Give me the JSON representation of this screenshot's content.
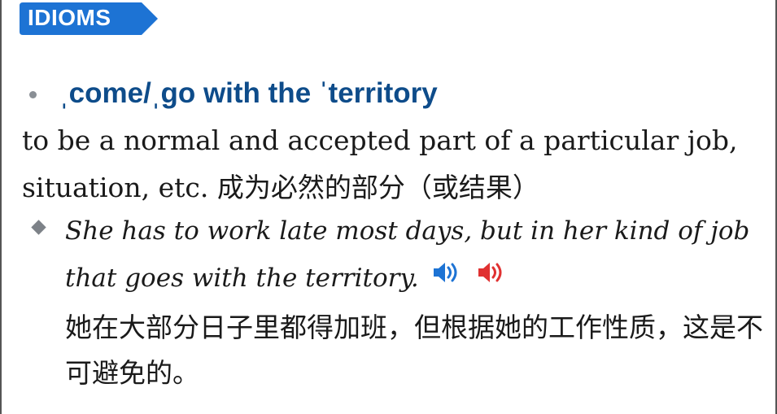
{
  "badge": {
    "label": "IDIOMS",
    "color": "#1d73d4"
  },
  "entry": {
    "headword": "ˌcome/ˌgo with the ˈterritory",
    "definition_en": "to be a normal and accepted part of a particular job, situation, etc.",
    "definition_zh": "成为必然的部分（或结果）",
    "example_en": "She has to work late most days, but in her kind of job that goes with the territory.",
    "example_zh": "她在大部分日子里都得加班，但根据她的工作性质，这是不可避免的。"
  },
  "audio": {
    "british": {
      "icon": "speaker-icon",
      "color": "#1d73d4"
    },
    "american": {
      "icon": "speaker-icon",
      "color": "#e03131"
    }
  },
  "colors": {
    "headword": "#0e4c8a",
    "text": "#1a1a1a",
    "bullet": "#8a8f95"
  }
}
